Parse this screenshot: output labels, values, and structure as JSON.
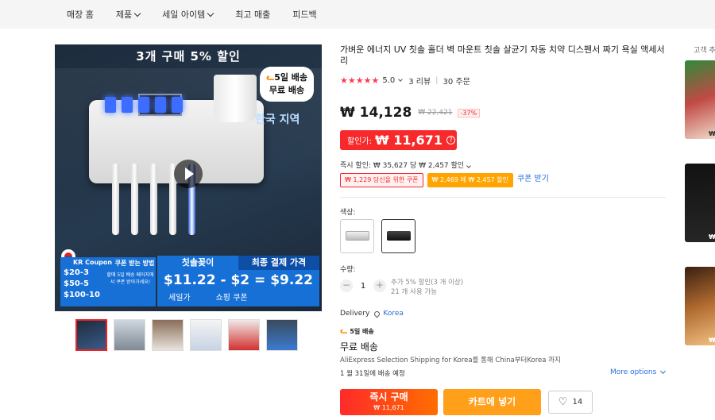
{
  "nav": {
    "items": [
      {
        "label": "매장 홈",
        "chevron": false
      },
      {
        "label": "제품",
        "chevron": true
      },
      {
        "label": "세일 아이템",
        "chevron": true
      },
      {
        "label": "최고 매출",
        "chevron": false
      },
      {
        "label": "피드백",
        "chevron": false
      }
    ]
  },
  "gallery": {
    "banner": "3개 구매 5% 할인",
    "shipping_bubble_line1": "5일 배송",
    "shipping_bubble_line2": "무료 배송",
    "region": "한국 지역",
    "coupon_title": "KR Coupon",
    "coupon_how": "쿠폰 받는 방법",
    "coupon_note": "할매 5일 배송 페이지에서 쿠폰 받아가세요!",
    "coupon_rows": [
      "$20-3",
      "$50-5",
      "$100-10"
    ],
    "price_head_1": "칫솔꽂이",
    "price_head_2": "최종 결제 가격",
    "price_formula": "$11.22 - $2 = $9.22",
    "price_label_1": "세일가",
    "price_label_2": "쇼핑 쿠폰",
    "thumbnails": 6
  },
  "product": {
    "title": "가벼운 에너지 UV 칫솔 홀더 벽 마운트 칫솔 살균기 자동 치약 디스펜서 짜기 욕실 액세서리",
    "rating": 5.0,
    "rating_text": "5.0",
    "stars": "★★★★★",
    "reviews": "3 리뷰",
    "orders": "30 주문",
    "price_now": "₩ 14,128",
    "price_old": "₩ 22,421",
    "discount": "-37%",
    "sale_label": "할인가:",
    "sale_amount": "₩ 11,671",
    "instant": "즉시 할인: ₩ 35,627 당 ₩ 2,457 할인",
    "coupon_1": "₩ 1,229 당신을 위한 쿠폰",
    "coupon_2": "₩ 2,469 에 ₩ 2,457 할인",
    "coupon_link": "쿠폰 받기",
    "color_label": "색상:",
    "qty_label": "수량:",
    "qty_value": "1",
    "qty_note_1": "추가 5% 할인(3 개 이상)",
    "qty_note_2": "21 개 사용 가능",
    "delivery_label": "Delivery",
    "delivery_loc": "Korea",
    "ship5": "5일 배송",
    "free_ship": "무료 배송",
    "via": "AliExpress Selection Shipping for Korea를 통해 China부터Korea 까지",
    "eta": "1 월 31일에 배송 예정",
    "more_options": "More options",
    "buy_now": "즉시 구매",
    "buy_now_price": "₩ 11,671",
    "add_cart": "카트에 넣기",
    "wishlist_count": "14"
  },
  "right_column": {
    "title": "고객 추천",
    "prices": [
      "₩",
      "₩",
      "₩"
    ]
  },
  "colors": {
    "accent_red": "#f7292b",
    "accent_orange": "#ffa400",
    "link_blue": "#2a6ed8"
  }
}
